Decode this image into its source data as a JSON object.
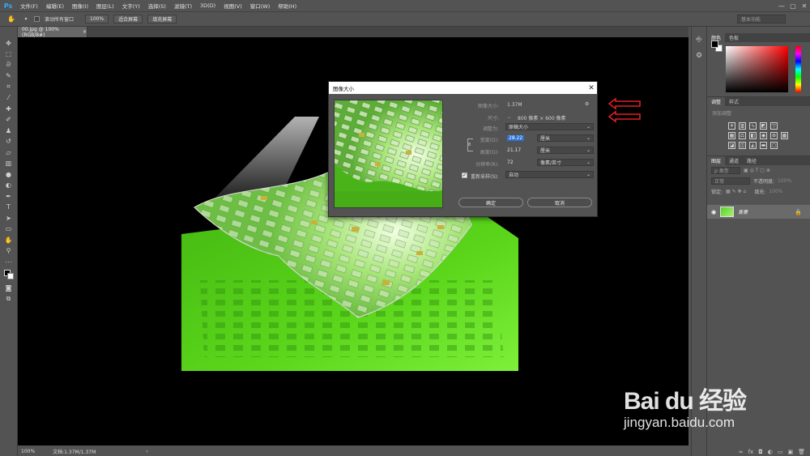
{
  "app": {
    "logo": "Ps"
  },
  "menu": [
    "文件(F)",
    "编辑(E)",
    "图像(I)",
    "图层(L)",
    "文字(Y)",
    "选择(S)",
    "滤镜(T)",
    "3D(D)",
    "视图(V)",
    "窗口(W)",
    "帮助(H)"
  ],
  "window_controls": {
    "minimize": "—",
    "maximize": "▢",
    "close": "✕"
  },
  "options_bar": {
    "scroll_all_label": "滚动所有窗口",
    "zoom_button": "100%",
    "fit_screen_button": "适合屏幕",
    "fill_screen_button": "填充屏幕",
    "workspace": "基本功能"
  },
  "document": {
    "tab_title": "00.jpg @ 100%(RGB/8#)",
    "tab_close": "×",
    "status_zoom": "100%",
    "status_doc": "文档:1.37M/1.37M",
    "status_arrow": "›"
  },
  "color_panel": {
    "tabs": [
      "颜色",
      "色板"
    ]
  },
  "adjust_panel": {
    "tabs": [
      "调整",
      "样式"
    ],
    "title": "添加调整"
  },
  "layers_panel": {
    "tabs": [
      "图层",
      "通道",
      "路径"
    ],
    "filter_kind": "ρ 类型",
    "blend_mode": "正常",
    "opacity_label": "不透明度:",
    "opacity": "100%",
    "lock_label": "锁定:",
    "fill_label": "填充:",
    "fill": "100%",
    "layer_name": "背景"
  },
  "dialog": {
    "title": "图像大小",
    "close": "✕",
    "image_size_label": "图像大小:",
    "image_size_value": "1.37M",
    "dimensions_label": "尺寸:",
    "dimensions_value": "800 像素 × 600 像素",
    "fit_to_label": "调整为:",
    "fit_to_value": "原稿大小",
    "width_label": "宽度(D):",
    "width_value": "28.22",
    "width_unit": "厘米",
    "height_label": "高度(G):",
    "height_value": "21.17",
    "height_unit": "厘米",
    "resolution_label": "分辨率(R):",
    "resolution_value": "72",
    "resolution_unit": "像素/英寸",
    "resample_label": "重新采样(S):",
    "resample_value": "自动",
    "resample_checked": "✓",
    "ok_button": "确定",
    "cancel_button": "取消"
  },
  "watermark": {
    "brand": "Bai du 经验",
    "url": "jingyan.baidu.com"
  },
  "colors": {
    "accent": "#31a8ff",
    "annotation_arrow": "#e02020",
    "scene_green": "#5ad11f"
  }
}
